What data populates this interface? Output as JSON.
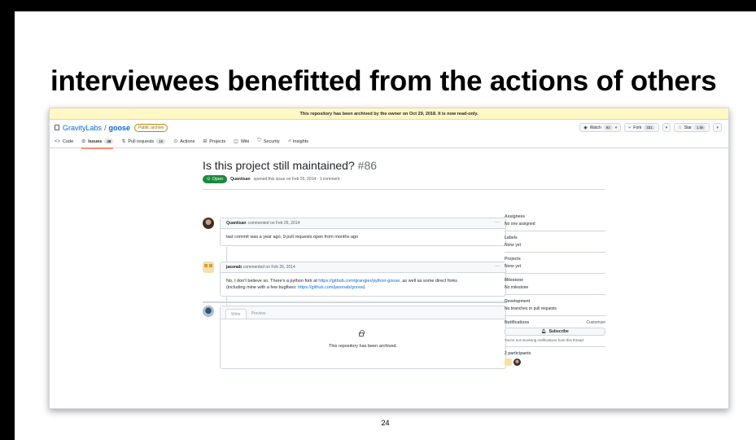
{
  "slide": {
    "title": "interviewees benefitted from the actions of others",
    "page_number": "24"
  },
  "banner": {
    "text": "This repository has been archived by the owner on Oct 29, 2018. It is now read-only."
  },
  "repo": {
    "owner": "GravityLabs",
    "separator": "/",
    "name": "goose",
    "visibility_badge": "Public archive",
    "watch_label": "Watch",
    "watch_count": "92",
    "fork_label": "Fork",
    "fork_count": "331",
    "star_label": "Star",
    "star_count": "1.5k"
  },
  "nav": {
    "code": "Code",
    "issues": "Issues",
    "issues_count": "48",
    "pulls": "Pull requests",
    "pulls_count": "16",
    "actions": "Actions",
    "projects": "Projects",
    "wiki": "Wiki",
    "security": "Security",
    "insights": "Insights"
  },
  "issue": {
    "title": "Is this project still maintained?",
    "number": "#86",
    "state": "Open",
    "author": "Quantisan",
    "meta_text": "opened this issue on Feb 26, 2014 · 1 comment"
  },
  "comments": [
    {
      "author": "Quantisan",
      "meta": "commented on Feb 26, 2014",
      "body": "last commit was a year ago, 9 pull requests open from months ago"
    },
    {
      "author": "jasonab",
      "meta": "commented on Feb 26, 2014",
      "body_1": "No, I don't believe so. There's a python fork at ",
      "link_1": "https://github.com/grangier/python-goose",
      "body_2": ", as well as some direct forks",
      "body_3": "(including mine with a few bugfixes: ",
      "link_2": "https://github.com/jasonab/goose",
      "body_4": ")"
    }
  ],
  "editor": {
    "tab_write": "Write",
    "tab_preview": "Preview",
    "archived_message": "This repository has been archived."
  },
  "sidebar": {
    "assignees_h": "Assignees",
    "assignees_v": "No one assigned",
    "labels_h": "Labels",
    "labels_v": "None yet",
    "projects_h": "Projects",
    "projects_v": "None yet",
    "milestone_h": "Milestone",
    "milestone_v": "No milestone",
    "development_h": "Development",
    "development_v": "No branches or pull requests",
    "notifications_h": "Notifications",
    "customize": "Customize",
    "subscribe": "Subscribe",
    "notifications_note": "You're not receiving notifications from this thread.",
    "participants_h": "2 participants"
  },
  "colors": {
    "open_green": "#1f883d",
    "link_blue": "#0969da",
    "banner_yellow": "#fff8c5",
    "active_tab": "#fd8c73"
  }
}
